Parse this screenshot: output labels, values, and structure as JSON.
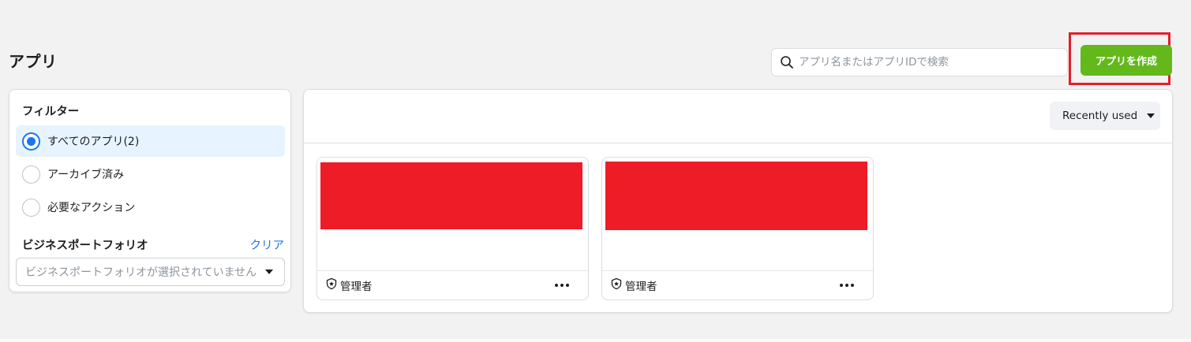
{
  "page": {
    "title": "アプリ"
  },
  "search": {
    "placeholder": "アプリ名またはアプリIDで検索",
    "value": ""
  },
  "create_button": {
    "label": "アプリを作成"
  },
  "filters": {
    "heading": "フィルター",
    "options": [
      {
        "label": "すべてのアプリ(2)",
        "selected": true
      },
      {
        "label": "アーカイブ済み",
        "selected": false
      },
      {
        "label": "必要なアクション",
        "selected": false
      }
    ],
    "business_portfolio": {
      "heading": "ビジネスポートフォリオ",
      "clear_label": "クリア",
      "select_placeholder": "ビジネスポートフォリオが選択されていません"
    }
  },
  "sort": {
    "label": "Recently used"
  },
  "apps": [
    {
      "role": "管理者",
      "thumbnail_color": "#ee1c27"
    },
    {
      "role": "管理者",
      "thumbnail_color": "#ee1c27"
    }
  ],
  "colors": {
    "accent_green": "#63b91b",
    "highlight_red": "#e41e2b",
    "link_blue": "#1877f2",
    "selected_bg": "#e7f3ff"
  },
  "icons": {
    "search": "search-icon",
    "role_badge": "shield-star-icon",
    "more": "more-horizontal-icon",
    "dropdown": "caret-down-icon"
  }
}
